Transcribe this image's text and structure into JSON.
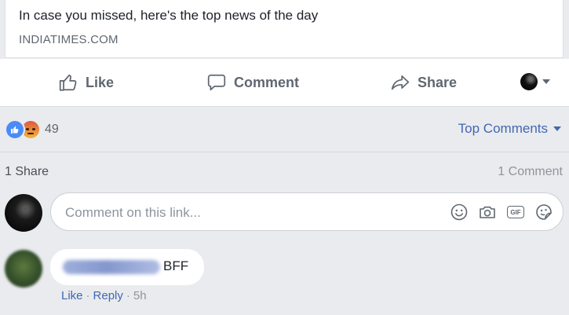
{
  "link_preview": {
    "description": "In case you missed, here's the top news of the day",
    "domain": "INDIATIMES.COM"
  },
  "actions": {
    "like": "Like",
    "comment": "Comment",
    "share": "Share"
  },
  "reactions": {
    "count": "49",
    "types": [
      "like",
      "angry"
    ],
    "sort_label": "Top Comments"
  },
  "stats": {
    "shares": "1 Share",
    "comments": "1 Comment"
  },
  "composer": {
    "placeholder": "Comment on this link...",
    "icons": [
      "smiley-icon",
      "camera-icon",
      "gif-icon",
      "sticker-icon"
    ]
  },
  "comments": [
    {
      "text": "BFF",
      "like_label": "Like",
      "separator": "·",
      "reply_label": "Reply",
      "time": "5h"
    }
  ],
  "colors": {
    "accent": "#4267b2",
    "muted": "#606770",
    "background": "#e9ebee"
  }
}
